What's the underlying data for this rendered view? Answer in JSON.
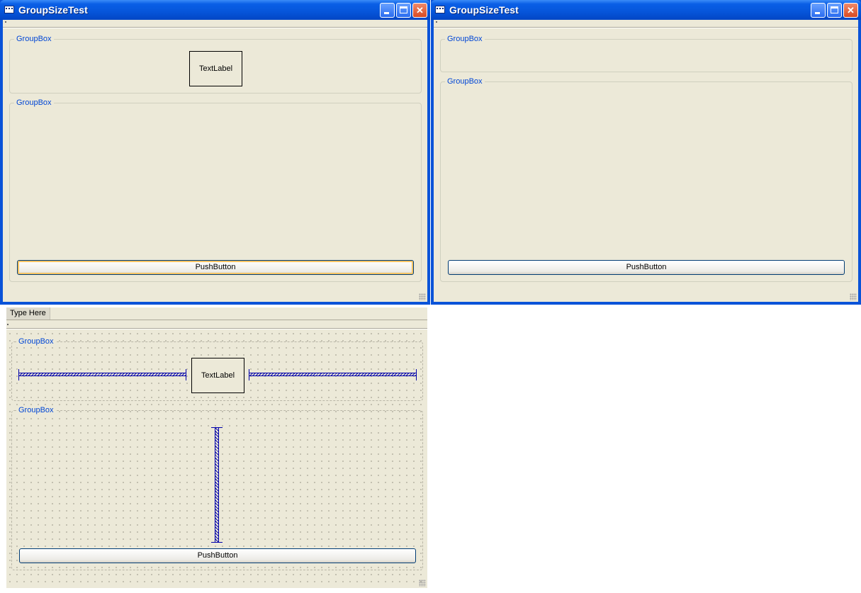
{
  "window_left": {
    "title": "GroupSizeTest",
    "group_top": {
      "title": "GroupBox",
      "label": "TextLabel"
    },
    "group_bottom": {
      "title": "GroupBox",
      "button": "PushButton"
    }
  },
  "window_right": {
    "title": "GroupSizeTest",
    "group_top": {
      "title": "GroupBox"
    },
    "group_bottom": {
      "title": "GroupBox",
      "button": "PushButton"
    }
  },
  "designer": {
    "menu_placeholder": "Type Here",
    "group_top": {
      "title": "GroupBox",
      "label": "TextLabel"
    },
    "group_bottom": {
      "title": "GroupBox",
      "button": "PushButton"
    }
  },
  "colors": {
    "titlebar": "#0a53d8",
    "groupbox_title": "#0046d5",
    "spacer": "#0000aa",
    "dialog_bg": "#ece9d8"
  }
}
